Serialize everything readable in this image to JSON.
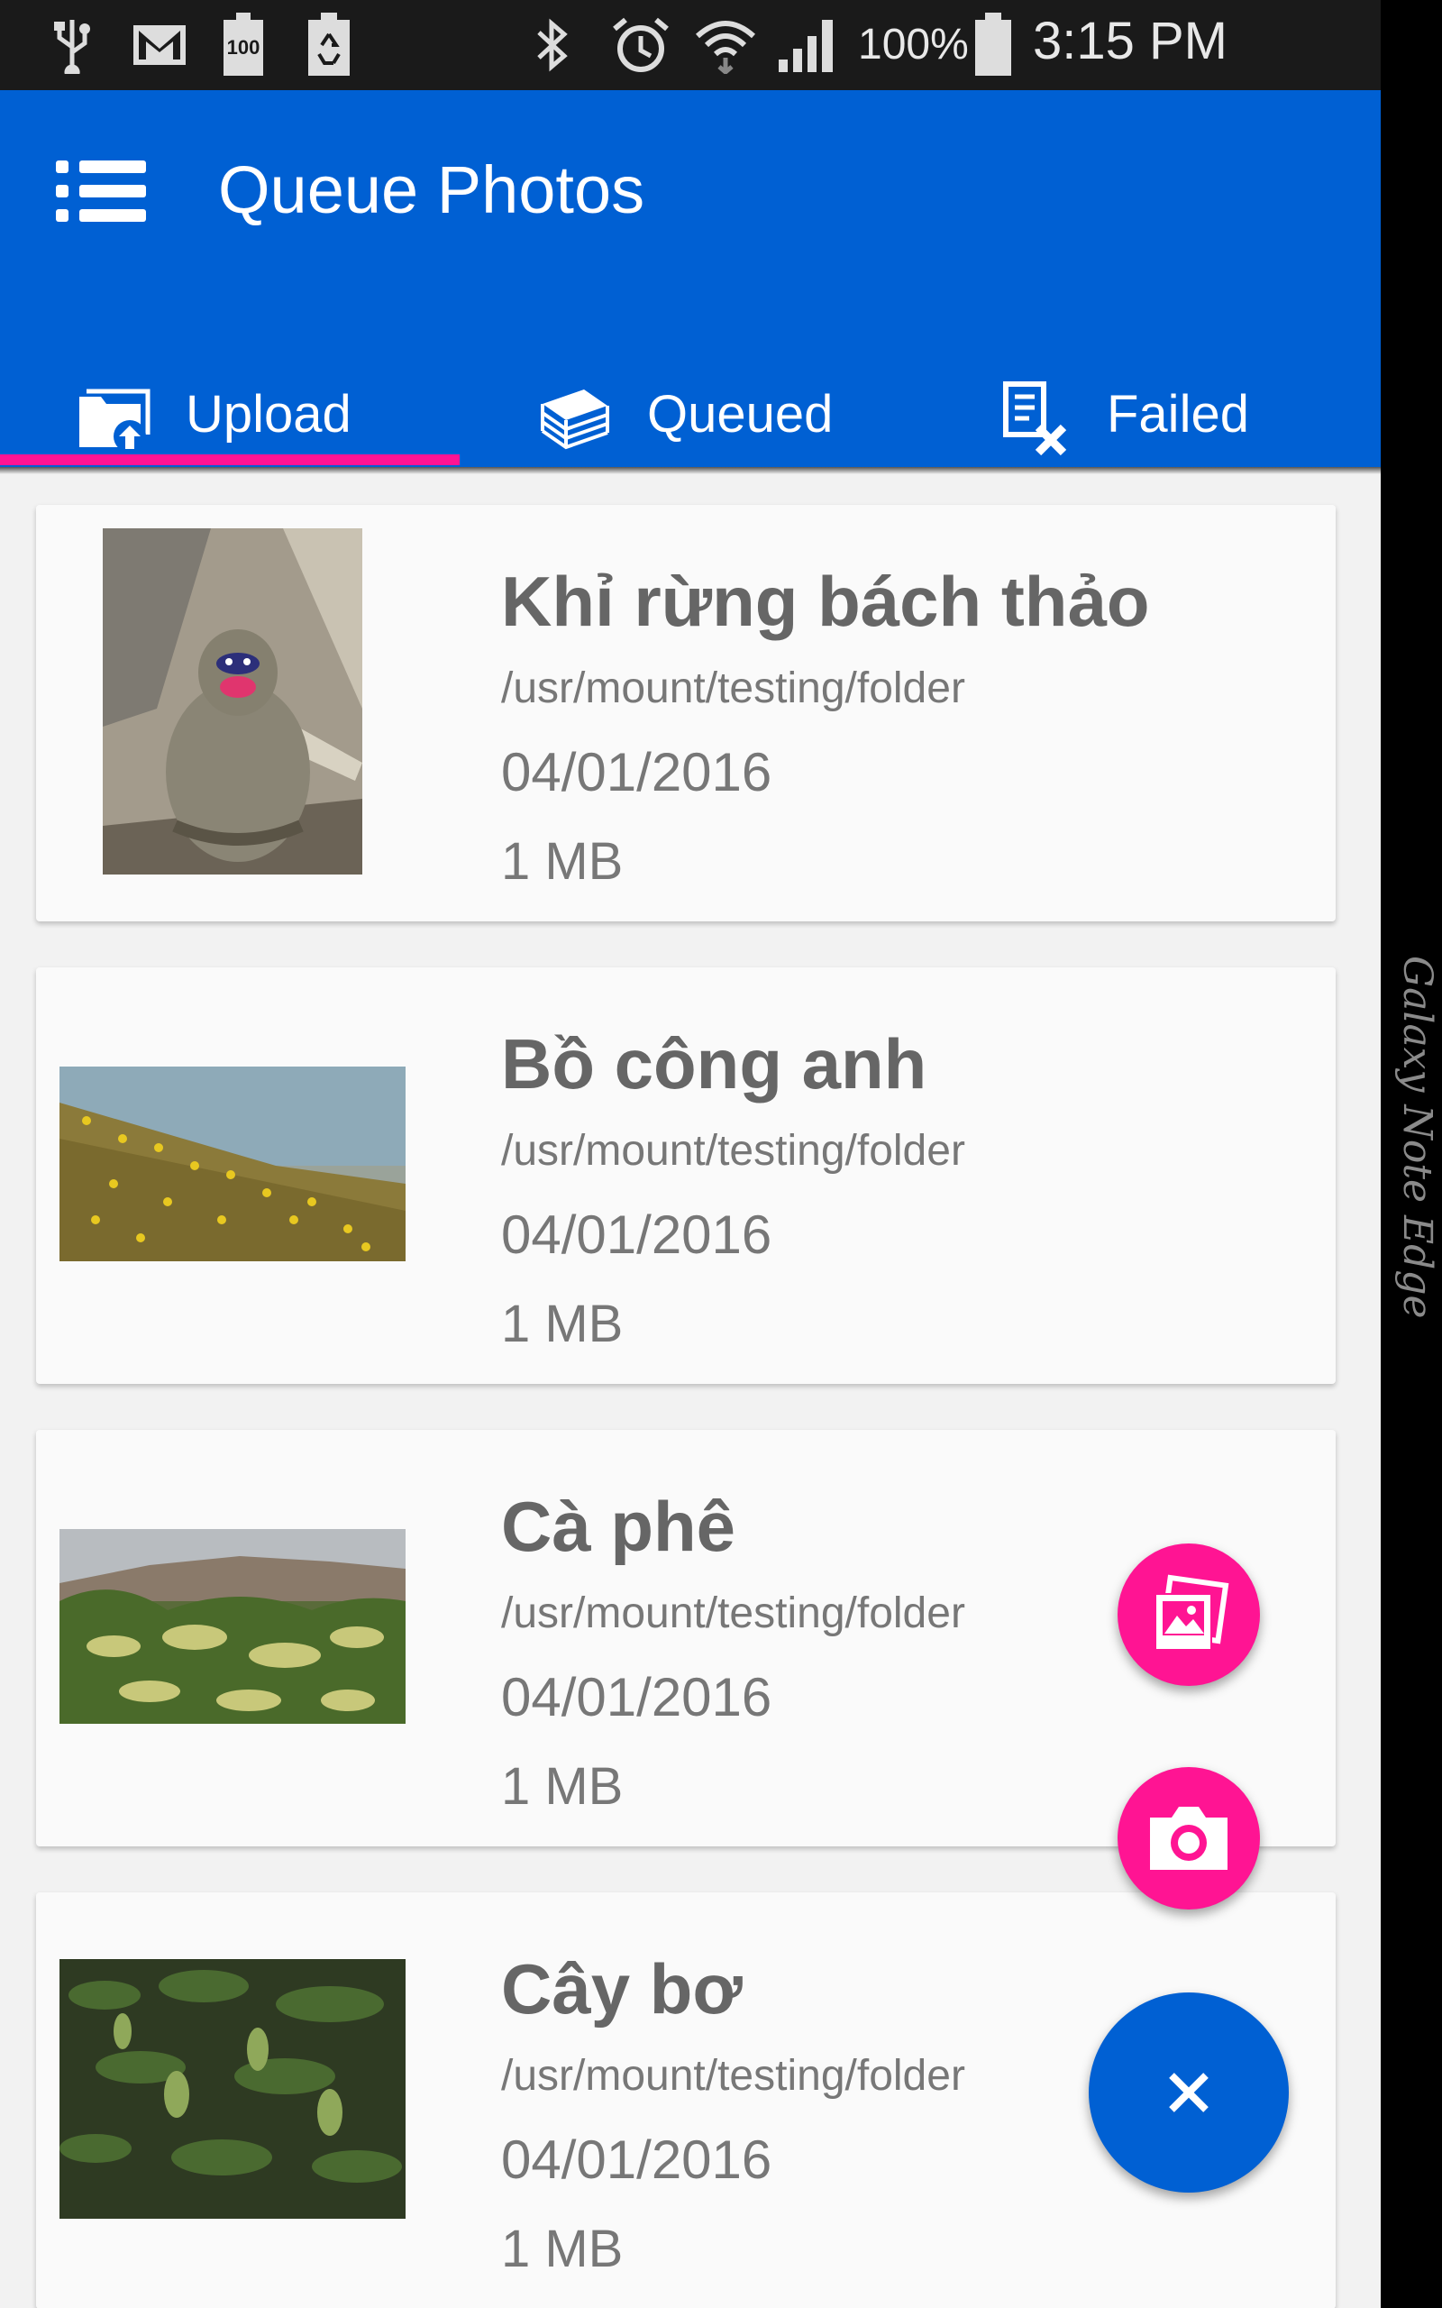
{
  "status_bar": {
    "battery_label": "100",
    "battery_percent": "100%",
    "time": "3:15 PM",
    "icons": [
      "usb-icon",
      "gmail-icon",
      "battery-100-icon",
      "recycle-icon",
      "bluetooth-icon",
      "alarm-icon",
      "wifi-icon",
      "signal-icon",
      "battery-icon"
    ]
  },
  "app_bar": {
    "title": "Queue Photos",
    "menu_icon": "menu-icon"
  },
  "tabs": [
    {
      "label": "Upload",
      "icon": "folder-upload-icon",
      "selected": true
    },
    {
      "label": "Queued",
      "icon": "stack-icon",
      "selected": false
    },
    {
      "label": "Failed",
      "icon": "document-failed-icon",
      "selected": false
    }
  ],
  "colors": {
    "primary": "#0060d3",
    "accent": "#ff1493",
    "background": "#f2f2f2",
    "card": "#fafafa"
  },
  "photos": [
    {
      "title": "Khỉ rừng bách thảo",
      "path": "/usr/mount/testing/folder",
      "date": "04/01/2016",
      "size": "1 MB"
    },
    {
      "title": "Bồ công anh",
      "path": "/usr/mount/testing/folder",
      "date": "04/01/2016",
      "size": "1 MB"
    },
    {
      "title": "Cà phê",
      "path": "/usr/mount/testing/folder",
      "date": "04/01/2016",
      "size": "1 MB"
    },
    {
      "title": "Cây bơ",
      "path": "/usr/mount/testing/folder",
      "date": "04/01/2016",
      "size": "1 MB"
    }
  ],
  "fabs": [
    "gallery-icon",
    "camera-icon",
    "close-icon"
  ],
  "device_label": "Galaxy Note Edge"
}
